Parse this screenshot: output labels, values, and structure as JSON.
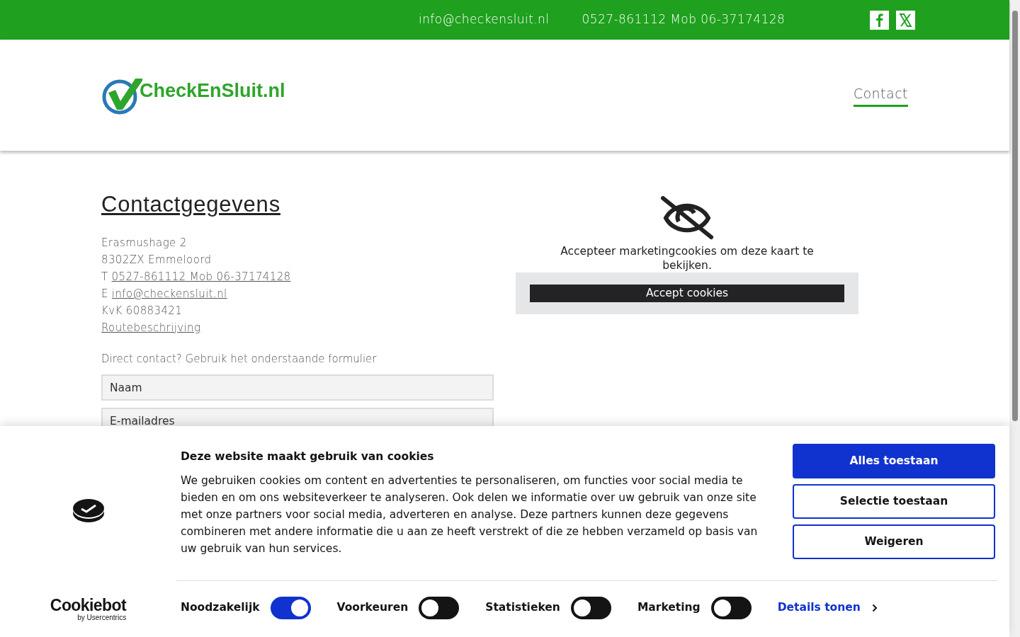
{
  "top_bar": {
    "email": "info@checkensluit.nl",
    "phone": "0527-861112 Mob 06-37174128",
    "social": [
      {
        "kind": "facebook"
      },
      {
        "kind": "x"
      }
    ]
  },
  "header": {
    "logo_text": "CheckEnSluit.nl",
    "nav": [
      {
        "label": "Contact",
        "selected": true
      }
    ]
  },
  "contact": {
    "title": "Contactgegevens",
    "lines": [
      {
        "kind": "text",
        "text": "Erasmushage 2"
      },
      {
        "kind": "text",
        "text": "8302ZX Emmeloord"
      },
      {
        "kind": "link",
        "prefix": "T",
        "text": "0527-861112 Mob 06-37174128"
      },
      {
        "kind": "link",
        "prefix": "E",
        "text": "info@checkensluit.nl"
      },
      {
        "kind": "text",
        "text": "KvK 60883421"
      },
      {
        "kind": "link",
        "text": "Routebeschrijving"
      }
    ],
    "form_intro": "Direct contact? Gebruik het onderstaande formulier",
    "fields": [
      {
        "placeholder": "Naam"
      },
      {
        "placeholder": "E-mailadres"
      }
    ]
  },
  "map_placeholder": {
    "message": "Accepteer marketingcookies om deze kaart te bekijken.",
    "button": "Accept cookies"
  },
  "cookie_banner": {
    "brand": "Cookiebot",
    "brand_sub": "by Usercentrics",
    "title": "Deze website maakt gebruik van cookies",
    "body": "We gebruiken cookies om content en advertenties te personaliseren, om functies voor social media te bieden en om ons websiteverkeer te analyseren. Ook delen we informatie over uw gebruik van onze site met onze partners voor social media, adverteren en analyse. Deze partners kunnen deze gegevens combineren met andere informatie die u aan ze heeft verstrekt of die ze hebben verzameld op basis van uw gebruik van hun services.",
    "buttons": [
      {
        "label": "Alles toestaan",
        "kind": "primary"
      },
      {
        "label": "Selectie toestaan",
        "kind": "outline"
      },
      {
        "label": "Weigeren",
        "kind": "outline"
      }
    ],
    "toggles": [
      {
        "label": "Noodzakelijk",
        "checked": true
      },
      {
        "label": "Voorkeuren",
        "checked": false
      },
      {
        "label": "Statistieken",
        "checked": false
      },
      {
        "label": "Marketing",
        "checked": false
      }
    ],
    "details_link": "Details tonen"
  }
}
